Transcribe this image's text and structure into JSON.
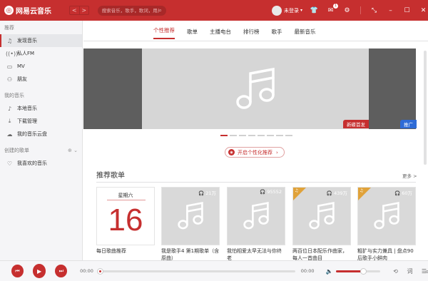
{
  "header": {
    "app_name": "网易云音乐",
    "back_glyph": "<",
    "forward_glyph": ">",
    "search_placeholder": "搜索音乐，歌手，歌词，用户",
    "user_label": "未登录",
    "message_badge": "1"
  },
  "sidebar": {
    "section_recommend": "推荐",
    "recommend_items": [
      {
        "label": "发现音乐",
        "icon": "music-note-icon"
      },
      {
        "label": "私人FM",
        "icon": "radio-icon"
      },
      {
        "label": "MV",
        "icon": "video-icon"
      },
      {
        "label": "朋友",
        "icon": "friends-icon"
      }
    ],
    "section_my_music": "我的音乐",
    "my_music_items": [
      {
        "label": "本地音乐",
        "icon": "local-music-icon"
      },
      {
        "label": "下载管理",
        "icon": "download-icon"
      },
      {
        "label": "我的音乐云盘",
        "icon": "cloud-icon"
      }
    ],
    "section_playlists": "创建的歌单",
    "playlist_items": [
      {
        "label": "我喜欢的音乐",
        "icon": "heart-icon"
      }
    ]
  },
  "main": {
    "tabs": [
      "个性推荐",
      "歌单",
      "主播电台",
      "排行榜",
      "歌手",
      "最新音乐"
    ],
    "active_tab": 0,
    "banner_tag_new": "新碟首发",
    "banner_tag_ad": "推广",
    "banner_dots": 8,
    "personal_button": "开启个性化推荐",
    "section_title": "推荐歌单",
    "section_more": "更多 >",
    "cards": [
      {
        "label": "每日歌曲推荐",
        "calendar_weekday": "星期六",
        "calendar_day": "16",
        "playcount": ""
      },
      {
        "label": "我是歌手4 第1期歌单（含原曲）",
        "playcount": "21万"
      },
      {
        "label": "我怕相爱太早无法与你终老",
        "playcount": "95552"
      },
      {
        "label": "两百位日本配乐作曲家，每人一首曲目",
        "playcount": "439万"
      },
      {
        "label": "粗犷与实力兼具 | 盘点90后歌手小鲜肉",
        "playcount": "60万"
      }
    ]
  },
  "player": {
    "current_time": "00:00",
    "total_time": "00:00",
    "progress_fraction": 0,
    "volume_fraction": 0.6,
    "playlist_count": "0"
  }
}
